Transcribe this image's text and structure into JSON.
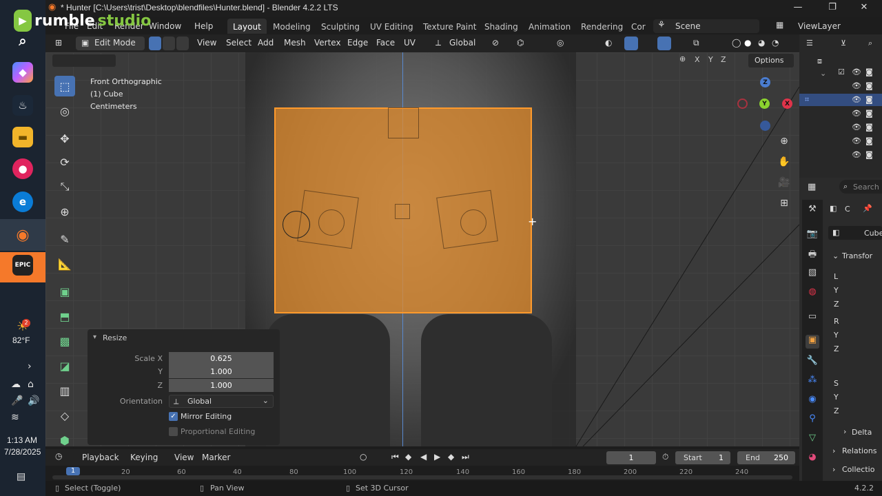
{
  "window": {
    "title": "* Hunter [C:\\Users\\trist\\Desktop\\blendfiles\\Hunter.blend] - Blender 4.2.2 LTS",
    "minimize": "—",
    "maximize": "❐",
    "close": "✕"
  },
  "overlay": {
    "brand_part1": "rumble",
    "brand_part2": "studio"
  },
  "taskbar": {
    "temperature": "82°F",
    "time": "1:13 AM",
    "date": "7/28/2025",
    "notification_count": "2"
  },
  "menu": {
    "items": [
      "File",
      "Edit",
      "Render",
      "Window",
      "Help"
    ],
    "workspaces": [
      "Layout",
      "Modeling",
      "Sculpting",
      "UV Editing",
      "Texture Paint",
      "Shading",
      "Animation",
      "Rendering",
      "Cor"
    ],
    "active_workspace": "Layout",
    "scene": "Scene",
    "view_layer": "ViewLayer"
  },
  "viewport_header": {
    "mode": "Edit Mode",
    "menus": [
      "View",
      "Select",
      "Add",
      "Mesh",
      "Vertex",
      "Edge",
      "Face",
      "UV"
    ],
    "transform_orientation": "Global",
    "options": "Options",
    "axis_x": "X",
    "axis_y": "Y",
    "axis_z": "Z"
  },
  "viewport": {
    "view_name": "Front Orthographic",
    "object_name": "(1) Cube",
    "units": "Centimeters"
  },
  "gizmo": {
    "x": "X",
    "y": "Y",
    "z": "Z"
  },
  "resize_panel": {
    "title": "Resize",
    "scale_x_label": "Scale X",
    "scale_x": "0.625",
    "scale_y_label": "Y",
    "scale_y": "1.000",
    "scale_z_label": "Z",
    "scale_z": "1.000",
    "orientation_label": "Orientation",
    "orientation": "Global",
    "mirror_editing": "Mirror Editing",
    "mirror_checked": true,
    "proportional_editing": "Proportional Editing",
    "proportional_checked": false
  },
  "properties": {
    "search_placeholder": "Search",
    "object_short": "C",
    "object_name": "Cube",
    "transform_label": "Transfor",
    "location_label": "L",
    "rotation_label": "R",
    "scale_label": "S",
    "y_label": "Y",
    "z_label": "Z",
    "delta": "Delta",
    "relations": "Relations",
    "collections": "Collectio"
  },
  "timeline": {
    "menus": [
      "Playback",
      "Keying",
      "View",
      "Marker"
    ],
    "current_frame": "1",
    "start_label": "Start",
    "start": "1",
    "end_label": "End",
    "end": "250",
    "ruler": [
      "1",
      "20",
      "60",
      "40",
      "80",
      "100",
      "120",
      "140",
      "160",
      "180",
      "200",
      "220",
      "240"
    ]
  },
  "statusbar": {
    "select": "Select (Toggle)",
    "pan": "Pan View",
    "cursor": "Set 3D Cursor",
    "version": "4.2.2"
  }
}
